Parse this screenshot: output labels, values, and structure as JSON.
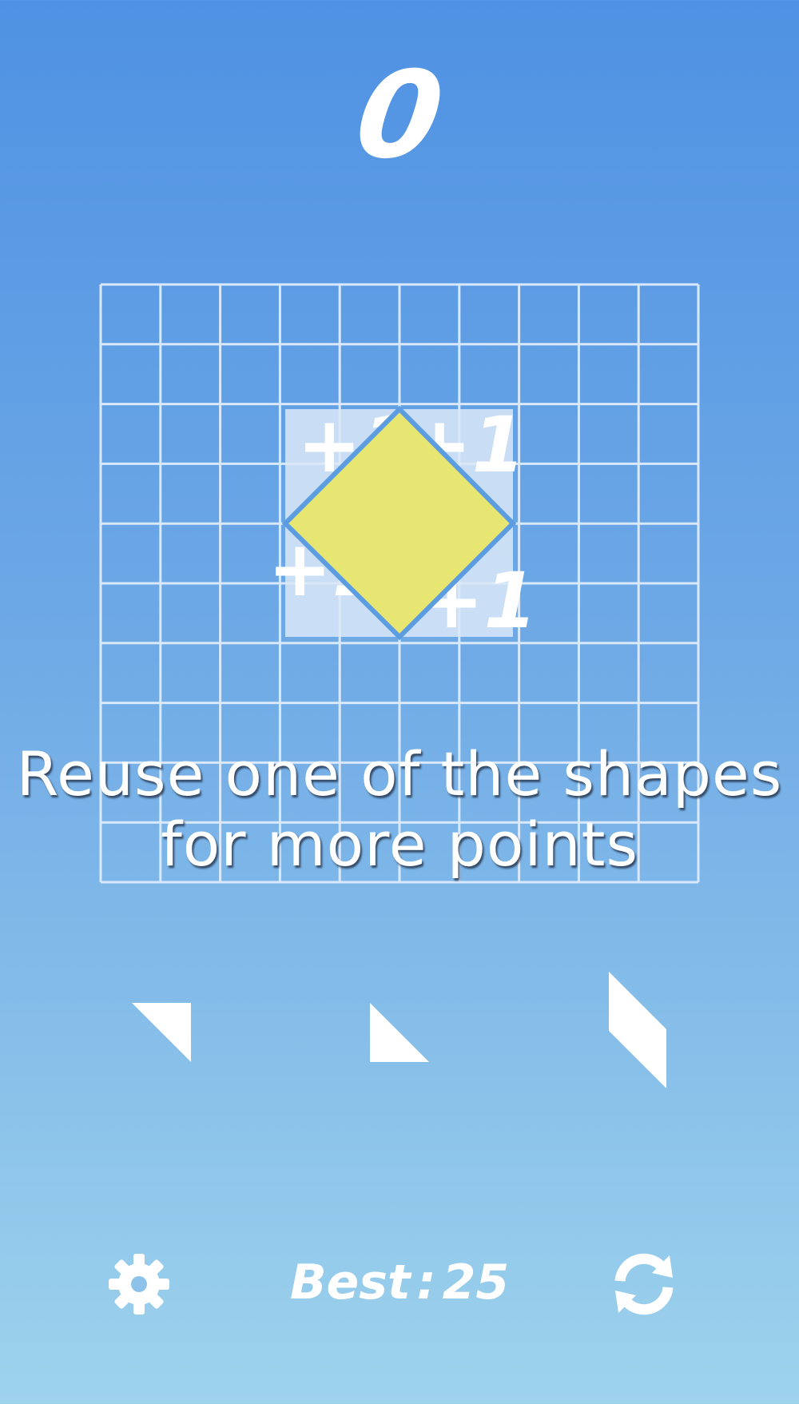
{
  "score": "0",
  "hint": {
    "line1": "Reuse one of the shapes",
    "line2": "for more points"
  },
  "board": {
    "rows": 10,
    "cols": 10,
    "grid_color": "#d9e9fb",
    "highlight_color": "#dbe8f7",
    "piece_color": "#e8e673",
    "bonus_labels": [
      "+1",
      "+1",
      "+1",
      "+1"
    ]
  },
  "tray": {
    "pieces": [
      {
        "name": "triangle-top-right"
      },
      {
        "name": "triangle-bottom-left"
      },
      {
        "name": "parallelogram"
      }
    ]
  },
  "best": {
    "label": "Best",
    "separator": ":",
    "value": "25"
  },
  "icons": {
    "settings": "gear-icon",
    "restart": "refresh-icon"
  },
  "colors": {
    "background_top": "#4f92e3",
    "background_bottom": "#9ed3ec",
    "text": "#ffffff"
  }
}
